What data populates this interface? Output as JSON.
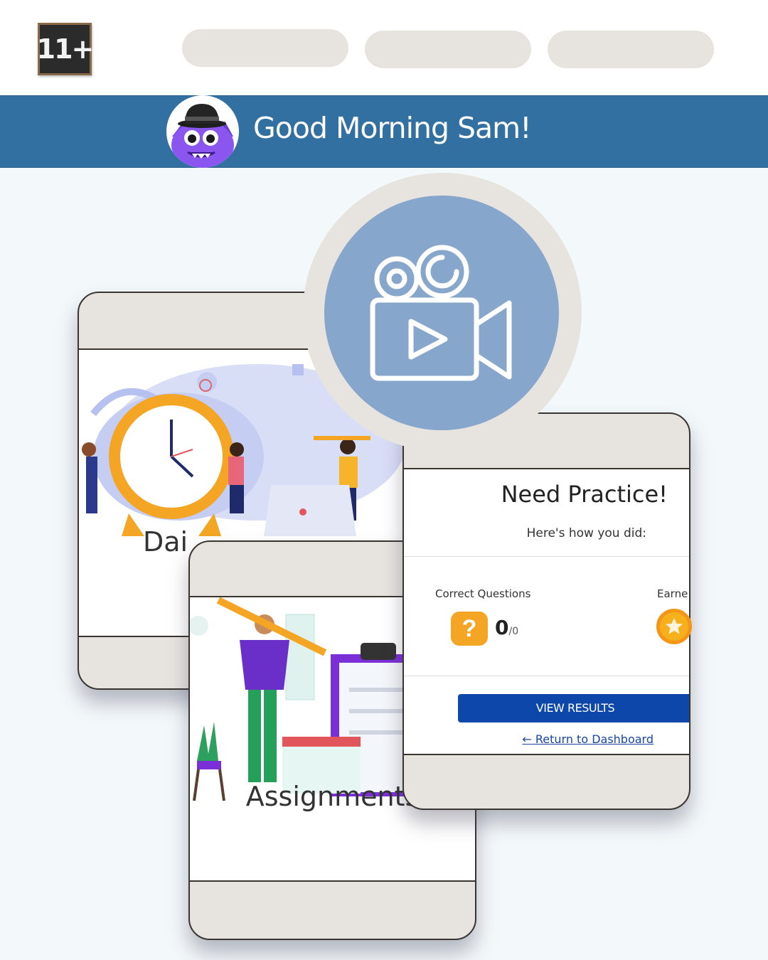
{
  "header": {
    "logo_text": "11+",
    "nav_pills": [
      "",
      "",
      ""
    ]
  },
  "banner": {
    "greeting": "Good Morning Sam!"
  },
  "cards": {
    "daily": {
      "label": "Dai"
    },
    "assignments": {
      "label": "Assignments"
    },
    "result": {
      "title": "Need Practice!",
      "subtitle": "Here's how you did:",
      "correct_label": "Correct Questions",
      "earned_label": "Earne",
      "score_value": "0",
      "score_total": "/0",
      "question_icon": "?",
      "view_button": "VIEW RESULTS",
      "return_link": "Return to Dashboard"
    }
  },
  "video": {
    "icon": "video-camera-icon"
  },
  "colors": {
    "banner": "#3270a2",
    "video_circle": "#87a6cb",
    "card_frame": "#e7e3df",
    "button": "#0d47a9"
  }
}
